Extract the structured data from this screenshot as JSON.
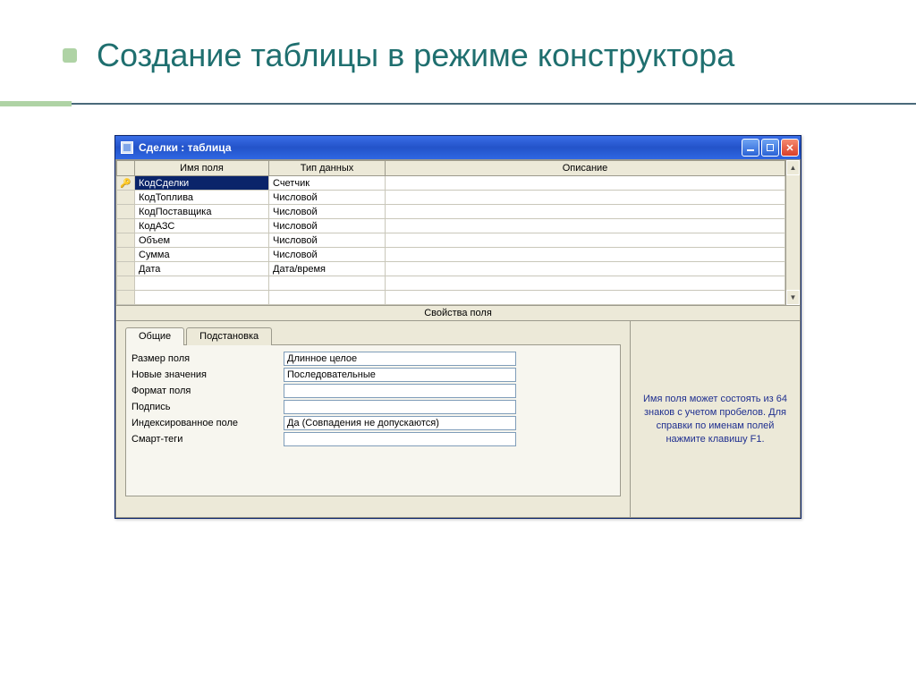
{
  "slide": {
    "title": "Создание таблицы в режиме конструктора"
  },
  "window": {
    "title": "Сделки : таблица",
    "minimize": "_",
    "maximize": "□",
    "close": "×"
  },
  "grid": {
    "headers": {
      "name": "Имя поля",
      "type": "Тип данных",
      "desc": "Описание"
    },
    "rows": [
      {
        "key": true,
        "name": "КодСделки",
        "type": "Счетчик",
        "desc": ""
      },
      {
        "key": false,
        "name": "КодТоплива",
        "type": "Числовой",
        "desc": ""
      },
      {
        "key": false,
        "name": "КодПоставщика",
        "type": "Числовой",
        "desc": ""
      },
      {
        "key": false,
        "name": "КодАЗС",
        "type": "Числовой",
        "desc": ""
      },
      {
        "key": false,
        "name": "Объем",
        "type": "Числовой",
        "desc": ""
      },
      {
        "key": false,
        "name": "Сумма",
        "type": "Числовой",
        "desc": ""
      },
      {
        "key": false,
        "name": "Дата",
        "type": "Дата/время",
        "desc": ""
      }
    ],
    "blank_rows": 2,
    "selected_index": 0
  },
  "properties": {
    "section_title": "Свойства поля",
    "tabs": {
      "general": "Общие",
      "lookup": "Подстановка"
    },
    "rows": [
      {
        "label": "Размер поля",
        "value": "Длинное целое"
      },
      {
        "label": "Новые значения",
        "value": "Последовательные"
      },
      {
        "label": "Формат поля",
        "value": ""
      },
      {
        "label": "Подпись",
        "value": ""
      },
      {
        "label": "Индексированное поле",
        "value": "Да (Совпадения не допускаются)"
      },
      {
        "label": "Смарт-теги",
        "value": ""
      }
    ]
  },
  "help": {
    "text": "Имя поля может состоять из 64 знаков с учетом пробелов.  Для справки по именам полей нажмите клавишу F1."
  }
}
